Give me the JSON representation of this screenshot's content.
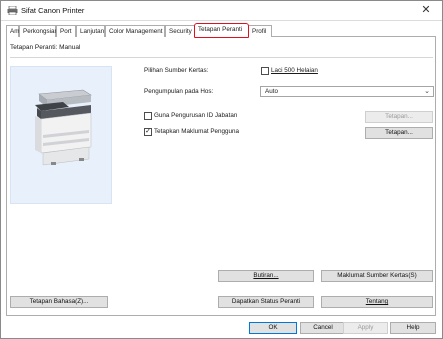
{
  "window": {
    "title": "Sifat Canon Printer",
    "close_glyph": "✕"
  },
  "tabs": [
    {
      "label": "Am"
    },
    {
      "label": "Perkongsian"
    },
    {
      "label": "Port"
    },
    {
      "label": "Lanjutan"
    },
    {
      "label": "Color Management"
    },
    {
      "label": "Security"
    },
    {
      "label": "Tetapan Peranti"
    },
    {
      "label": "Profil"
    }
  ],
  "panel": {
    "mode_label": "Tetapan Peranti: Manual",
    "paper_source_label": "Pilihan Sumber Kertas:",
    "drawer_checkbox": {
      "label": "Laci 500 Helaian",
      "checked": false
    },
    "collection_label": "Pengumpulan pada Hos:",
    "collection_select": {
      "value": "Auto"
    },
    "dept_id": {
      "label": "Guna Pengurusan ID Jabatan",
      "checked": false,
      "button": "Tetapan..."
    },
    "user_info": {
      "label": "Tetapkan Maklumat Pengguna",
      "checked": true,
      "button": "Tetapan..."
    },
    "buttons": {
      "options": "Butiran...",
      "paper_source_info": "Maklumat Sumber Kertas(S)",
      "language": "Tetapan Bahasa(Z)...",
      "get_status": "Dapatkan Status Peranti",
      "about": "Tentang"
    }
  },
  "footer": {
    "ok": "OK",
    "cancel": "Cancel",
    "apply": "Apply",
    "help": "Help"
  },
  "colors": {
    "highlight": "#e0101e",
    "printer_bg": "#e8f1fb"
  }
}
